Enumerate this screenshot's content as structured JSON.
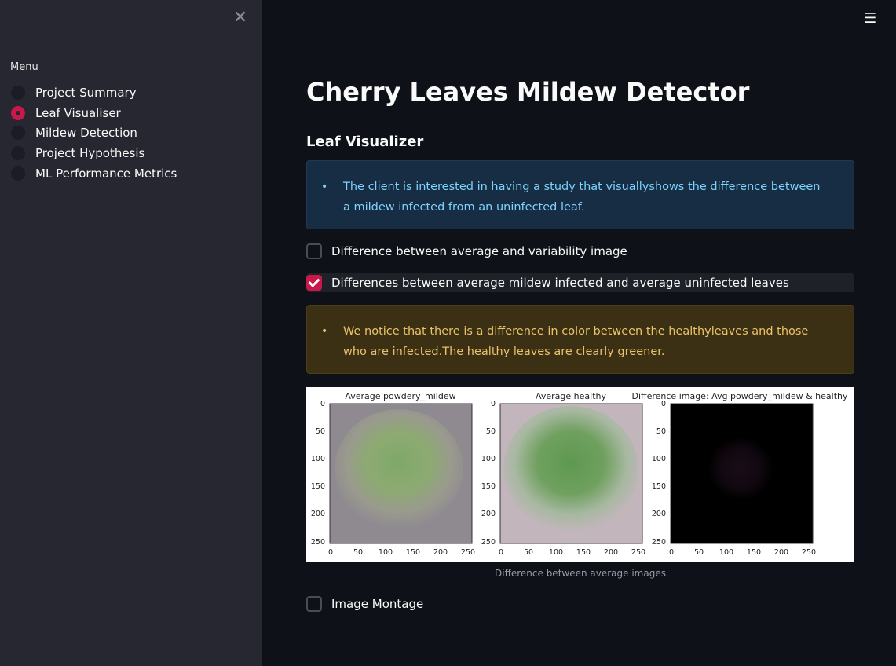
{
  "sidebar": {
    "menu_title": "Menu",
    "items": [
      {
        "label": "Project Summary",
        "selected": false
      },
      {
        "label": "Leaf Visualiser",
        "selected": true
      },
      {
        "label": "Mildew Detection",
        "selected": false
      },
      {
        "label": "Project Hypothesis",
        "selected": false
      },
      {
        "label": "ML Performance Metrics",
        "selected": false
      }
    ]
  },
  "main": {
    "title": "Cherry Leaves Mildew Detector",
    "section_title": "Leaf Visualizer",
    "info_text": "The client is interested in having a study that visuallyshows the difference between a mildew infected from an uninfected leaf.",
    "checkboxes": [
      {
        "label": "Difference between average and variability image",
        "checked": false
      },
      {
        "label": "Differences between average mildew infected and average uninfected leaves",
        "checked": true
      }
    ],
    "warning_text": "We notice that there is a difference in color between the healthyleaves and those who are infected.The healthy leaves are clearly greener.",
    "figure": {
      "panels": [
        {
          "title": "Average powdery_mildew"
        },
        {
          "title": "Average healthy"
        },
        {
          "title": "Difference image: Avg powdery_mildew & healthy"
        }
      ],
      "ticks": [
        "0",
        "50",
        "100",
        "150",
        "200",
        "250"
      ],
      "caption": "Difference between average images"
    },
    "montage_checkbox": {
      "label": "Image Montage",
      "checked": false
    }
  },
  "colors": {
    "accent": "#c9184a",
    "background": "#0e1117",
    "sidebar": "#262730",
    "info_bg": "#172d43",
    "info_text": "#7dd3fc",
    "warning_bg": "#3b3014",
    "warning_text": "#eac26a"
  },
  "icons": {
    "close": "close-icon",
    "menu": "hamburger-menu-icon",
    "check": "checkmark-icon"
  }
}
